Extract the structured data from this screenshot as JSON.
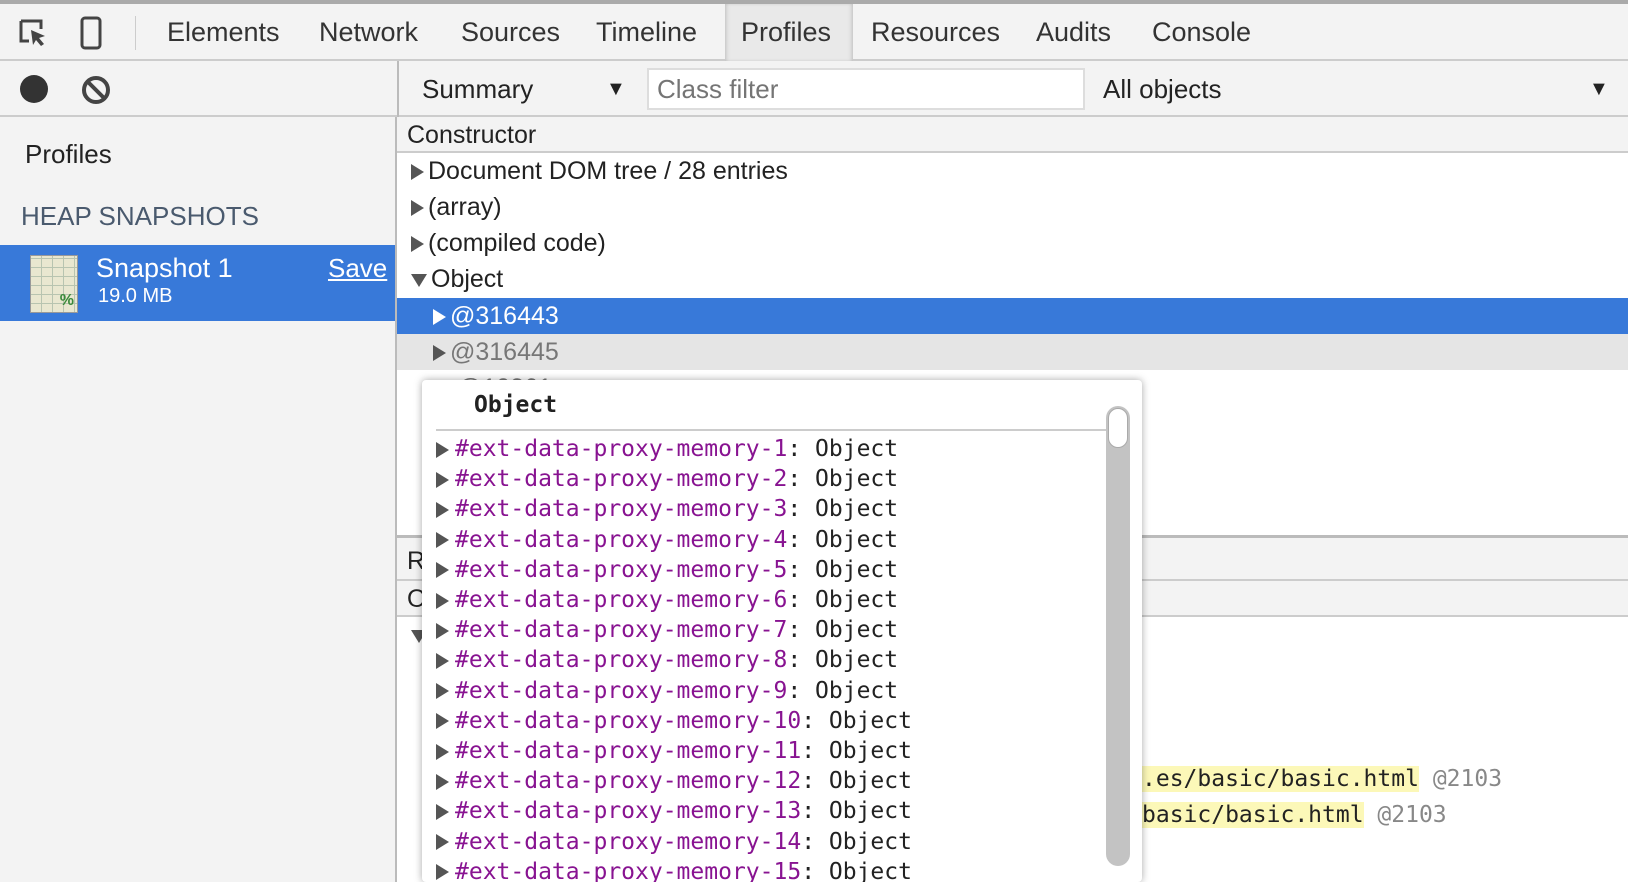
{
  "tabs": [
    {
      "label": "Elements"
    },
    {
      "label": "Network"
    },
    {
      "label": "Sources"
    },
    {
      "label": "Timeline"
    },
    {
      "label": "Profiles",
      "active": true
    },
    {
      "label": "Resources"
    },
    {
      "label": "Audits"
    },
    {
      "label": "Console"
    }
  ],
  "toolbar": {
    "view": "Summary",
    "class_filter_placeholder": "Class filter",
    "objects_filter": "All objects"
  },
  "sidebar": {
    "title": "Profiles",
    "section": "HEAP SNAPSHOTS",
    "snapshot": {
      "name": "Snapshot 1",
      "size": "19.0 MB",
      "save": "Save"
    }
  },
  "table": {
    "header": "Constructor",
    "rows": [
      "Document DOM tree / 28 entries",
      "(array)",
      "(compiled code)",
      "Object"
    ],
    "children": [
      "@316443",
      "@316445",
      "@10261"
    ]
  },
  "lower": {
    "r_label": "R",
    "o_label": "O",
    "lines": [
      {
        "text": ".es/basic/basic.html",
        "id": "@2103"
      },
      {
        "text": "basic/basic.html",
        "id": "@2103"
      }
    ]
  },
  "popover": {
    "title": "Object",
    "items": [
      {
        "key": "#ext-data-proxy-memory-1",
        "value": "Object"
      },
      {
        "key": "#ext-data-proxy-memory-2",
        "value": "Object"
      },
      {
        "key": "#ext-data-proxy-memory-3",
        "value": "Object"
      },
      {
        "key": "#ext-data-proxy-memory-4",
        "value": "Object"
      },
      {
        "key": "#ext-data-proxy-memory-5",
        "value": "Object"
      },
      {
        "key": "#ext-data-proxy-memory-6",
        "value": "Object"
      },
      {
        "key": "#ext-data-proxy-memory-7",
        "value": "Object"
      },
      {
        "key": "#ext-data-proxy-memory-8",
        "value": "Object"
      },
      {
        "key": "#ext-data-proxy-memory-9",
        "value": "Object"
      },
      {
        "key": "#ext-data-proxy-memory-10",
        "value": "Object"
      },
      {
        "key": "#ext-data-proxy-memory-11",
        "value": "Object"
      },
      {
        "key": "#ext-data-proxy-memory-12",
        "value": "Object"
      },
      {
        "key": "#ext-data-proxy-memory-13",
        "value": "Object"
      },
      {
        "key": "#ext-data-proxy-memory-14",
        "value": "Object"
      },
      {
        "key": "#ext-data-proxy-memory-15",
        "value": "Object"
      }
    ]
  },
  "colors": {
    "selection": "#3879d9",
    "property_key": "#881391",
    "highlight": "#fcf8b8"
  }
}
